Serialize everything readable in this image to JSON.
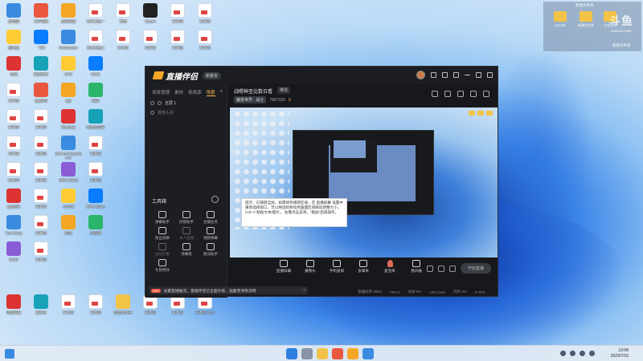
{
  "desktop": {
    "icons": [
      {
        "label": "此电脑",
        "kind": "pc"
      },
      {
        "label": "工作需要",
        "kind": "app"
      },
      {
        "label": "远程桌面",
        "kind": "app"
      },
      {
        "label": "文件文档一",
        "kind": "file"
      },
      {
        "label": "文档",
        "kind": "file"
      },
      {
        "label": "Steam",
        "kind": "app"
      },
      {
        "label": "日本的",
        "kind": "file"
      },
      {
        "label": "日本的",
        "kind": "file"
      },
      {
        "label": "回收站",
        "kind": "recycle"
      },
      {
        "label": "飞书",
        "kind": "app"
      },
      {
        "label": "Mindmaster",
        "kind": "app"
      },
      {
        "label": "文件文档二",
        "kind": "file"
      },
      {
        "label": "日本的",
        "kind": "file"
      },
      {
        "label": "日本的",
        "kind": "file"
      },
      {
        "label": "日本的",
        "kind": "file"
      },
      {
        "label": "日本的",
        "kind": "file"
      },
      {
        "label": "有道",
        "kind": "app"
      },
      {
        "label": "魔兽世界",
        "kind": "app"
      },
      {
        "label": "GPD",
        "kind": "app"
      },
      {
        "label": "DWG",
        "kind": "app"
      },
      {
        "label": "日本的",
        "kind": "file"
      },
      {
        "label": "QQ影音",
        "kind": "app"
      },
      {
        "label": "QQ",
        "kind": "app"
      },
      {
        "label": "微信",
        "kind": "app"
      },
      {
        "label": "日本的",
        "kind": "file"
      },
      {
        "label": "日本的",
        "kind": "file"
      },
      {
        "label": "Bandizip",
        "kind": "app"
      },
      {
        "label": "网易云音乐",
        "kind": "app"
      },
      {
        "label": "日本的",
        "kind": "file"
      },
      {
        "label": "日本的",
        "kind": "file"
      },
      {
        "label": "GeForce Experience",
        "kind": "app"
      },
      {
        "label": "日本的",
        "kind": "file"
      },
      {
        "label": "2023年",
        "kind": "file"
      },
      {
        "label": "日本的",
        "kind": "file"
      },
      {
        "label": "OBS Studio",
        "kind": "app"
      },
      {
        "label": "日本的",
        "kind": "file"
      },
      {
        "label": "QQ音乐",
        "kind": "app"
      },
      {
        "label": "日本的",
        "kind": "file"
      },
      {
        "label": "小红书",
        "kind": "app"
      },
      {
        "label": "WPS Office",
        "kind": "app"
      },
      {
        "label": "Tree Diary",
        "kind": "app"
      },
      {
        "label": "日本的",
        "kind": "file"
      },
      {
        "label": "迅雷",
        "kind": "app"
      },
      {
        "label": "浏览器",
        "kind": "app"
      },
      {
        "label": "DWG",
        "kind": "app"
      },
      {
        "label": "日本的",
        "kind": "file"
      },
      {
        "label": "电脑管家",
        "kind": "app"
      },
      {
        "label": "爱奇艺",
        "kind": "app"
      },
      {
        "label": "日本的",
        "kind": "file"
      },
      {
        "label": "日本的",
        "kind": "file"
      },
      {
        "label": "新建文件夹",
        "kind": "folder"
      },
      {
        "label": "日本的",
        "kind": "file"
      },
      {
        "label": "日本的",
        "kind": "file"
      },
      {
        "label": "日本的 ACV",
        "kind": "file"
      }
    ],
    "folder_panel": {
      "title": "新建文件夹",
      "folders": [
        {
          "label": "2023年"
        },
        {
          "label": "新建文件夹"
        },
        {
          "label": "工作文件"
        }
      ],
      "bottom_label": "新建文件夹"
    },
    "watermark": {
      "main": "斗鱼",
      "sub": "DOUYU.COM"
    }
  },
  "app": {
    "logo_text": "直播伴侣",
    "badge": "新版本",
    "left_tabs": [
      "场景管理",
      "素材",
      "视频源",
      "场景"
    ],
    "scenes": [
      {
        "label": "全屏 1"
      },
      {
        "label": "摄像头源"
      }
    ],
    "tools_title": "工具箱",
    "tools": [
      {
        "label": "弹幕助手",
        "icon": "danmaku-icon"
      },
      {
        "label": "房管助手",
        "icon": "admin-icon"
      },
      {
        "label": "主播任务",
        "icon": "task-icon"
      },
      {
        "label": "粉丝勋章",
        "icon": "medal-icon"
      },
      {
        "label": "本人直播",
        "icon": "live-icon",
        "dim": true
      },
      {
        "label": "视频弹幕",
        "icon": "video-icon"
      },
      {
        "label": "虚拟形象",
        "icon": "avatar-icon",
        "dim": true
      },
      {
        "label": "弹幕姬",
        "icon": "danmaku-robot-icon"
      },
      {
        "label": "歌词助手",
        "icon": "lyrics-icon"
      },
      {
        "label": "礼物特效",
        "icon": "gift-icon"
      }
    ],
    "stream_title": "战嗯神圣比数日看",
    "edit_label": "修改",
    "meta": {
      "category": "魔兽世界 · 战士",
      "viewers": "7857325",
      "status": "0"
    },
    "controls": [
      {
        "label": "直播屏幕",
        "icon": "screen-icon"
      },
      {
        "label": "摄像头",
        "icon": "camera-icon"
      },
      {
        "label": "手机投屏",
        "icon": "phone-icon"
      },
      {
        "label": "多媒体",
        "icon": "media-icon"
      },
      {
        "label": "麦克风",
        "icon": "mic-icon"
      },
      {
        "label": "扬声器",
        "icon": "speaker-icon"
      }
    ],
    "start_button": "开始直播",
    "status_items": [
      "直播码率 0kb/s",
      "FPS 0",
      "丢帧 0%",
      "CPU 24%",
      "内存 0%",
      "0 FPS"
    ],
    "notice_hot": "HOT",
    "notice_text": "设置直播推流，直播伴侣已全面升级，画面更清晰流畅",
    "tooltip_text": "提示：已捕获全屏。如需修改捕获区域，在 直播屏幕 设置中重新选择窗口，可以将鼠标移动到画面区域拖动调整大小。Ctrl+V 粘贴文本/图片。 右键点击菜单，“粘贴”后再操作。"
  },
  "taskbar": {
    "time": "12:08",
    "date": "2023/7/16"
  },
  "colors": {
    "accent": "#ffb84d",
    "app_bg": "#17181c",
    "mic": "#e46a5a"
  }
}
